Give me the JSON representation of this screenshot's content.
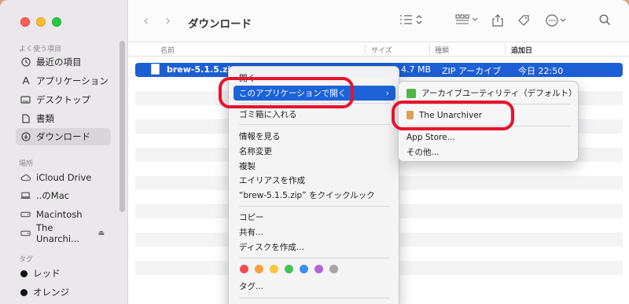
{
  "window": {
    "title": "ダウンロード"
  },
  "sidebar": {
    "favorites_header": "よく使う項目",
    "favorites": [
      {
        "label": "最近の項目",
        "icon": "clock-icon"
      },
      {
        "label": "アプリケーション",
        "icon": "apps-icon"
      },
      {
        "label": "デスクトップ",
        "icon": "desktop-icon"
      },
      {
        "label": "書類",
        "icon": "document-icon"
      },
      {
        "label": "ダウンロード",
        "icon": "download-icon",
        "selected": true
      }
    ],
    "locations_header": "場所",
    "locations": [
      {
        "label": "iCloud Drive",
        "icon": "cloud-icon"
      },
      {
        "label": "..のMac",
        "icon": "laptop-icon"
      },
      {
        "label": "Macintosh",
        "icon": "disk-icon"
      },
      {
        "label": "The Unarchi...",
        "icon": "disk-icon",
        "eject": true
      }
    ],
    "tags_header": "タグ",
    "tags": [
      {
        "label": "レッド",
        "color": "#111111"
      },
      {
        "label": "オレンジ",
        "color": "#111111"
      }
    ]
  },
  "columns": {
    "name": "名前",
    "size": "サイズ",
    "kind": "種類",
    "date": "追加日"
  },
  "file": {
    "name": "brew-5.1.5.zip",
    "size": "4.7 MB",
    "kind": "ZIP アーカイブ",
    "date": "今日 22:50"
  },
  "context_menu": {
    "open": "開く",
    "open_with": "このアプリケーションで開く",
    "trash": "ゴミ箱に入れる",
    "get_info": "情報を見る",
    "rename": "名称変更",
    "duplicate": "複製",
    "make_alias": "エイリアスを作成",
    "quick_look": "“brew-5.1.5.zip” をクイックルック",
    "copy": "コピー",
    "share": "共有...",
    "burn": "ディスクを作成...",
    "tags": "タグ...",
    "tag_colors": [
      "#ee4d4d",
      "#f5a03c",
      "#f6c83c",
      "#46c25a",
      "#3a8ef0",
      "#b264d9",
      "#a6a6a6"
    ]
  },
  "submenu": {
    "archive_utility": "アーカイブユーティリティ（デフォルト）",
    "unarchiver": "The Unarchiver",
    "app_store": "App Store...",
    "other": "その他..."
  },
  "colors": {
    "selection": "#1c5fd4",
    "annotation": "#e8122b"
  }
}
